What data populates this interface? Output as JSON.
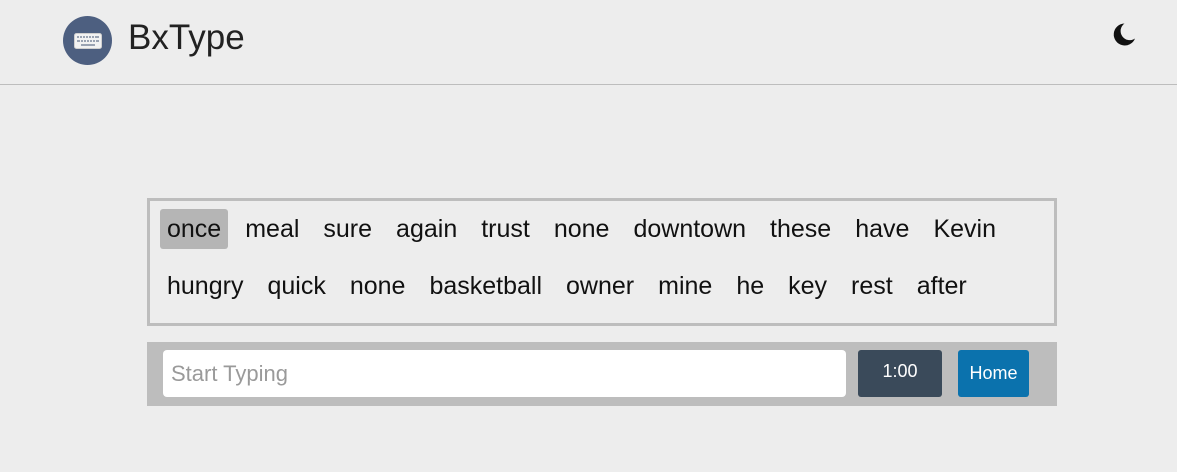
{
  "header": {
    "brand": "BxType",
    "logo_icon": "keyboard-icon",
    "theme_icon": "moon-icon"
  },
  "words": [
    "once",
    "meal",
    "sure",
    "again",
    "trust",
    "none",
    "downtown",
    "these",
    "have",
    "Kevin",
    "hungry",
    "quick",
    "none",
    "basketball",
    "owner",
    "mine",
    "he",
    "key",
    "rest",
    "after"
  ],
  "current_word_index": 0,
  "controls": {
    "input_value": "",
    "input_placeholder": "Start Typing",
    "timer": "1:00",
    "home_label": "Home"
  },
  "colors": {
    "background": "#ededed",
    "logo": "#4d5f80",
    "timer": "#3a4a5a",
    "home_button": "#0b72ad",
    "highlight": "#b5b5b5"
  }
}
